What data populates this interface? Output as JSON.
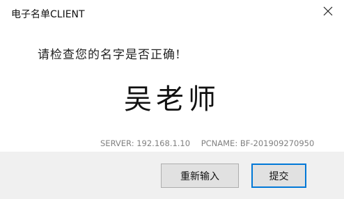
{
  "window": {
    "title": "电子名单CLIENT",
    "close_icon": "close-icon"
  },
  "main": {
    "prompt": "请检查您的名字是否正确!",
    "name": "吴老师"
  },
  "info": {
    "server_label": "SERVER: 192.168.1.10",
    "pcname_label": "PCNAME: BF-201909270950"
  },
  "footer": {
    "reenter_label": "重新输入",
    "submit_label": "提交"
  },
  "colors": {
    "footer_bg": "#f0f0f0",
    "button_bg": "#e1e1e1",
    "default_button_border": "#0078d7",
    "info_text": "#808080"
  }
}
